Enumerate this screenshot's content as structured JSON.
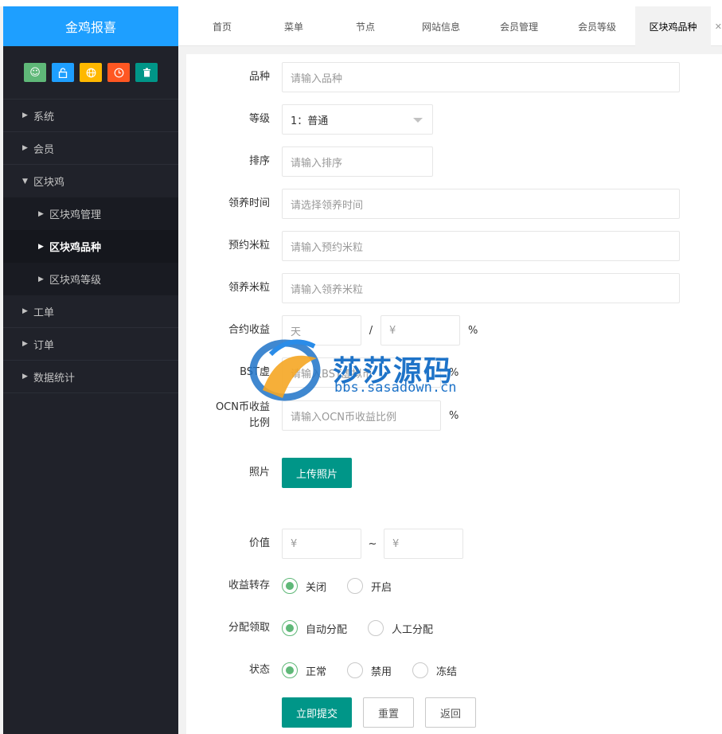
{
  "app": {
    "title": "金鸡报喜"
  },
  "quick_icons": [
    {
      "name": "user-icon",
      "color": "#5fb878",
      "glyph": "☺"
    },
    {
      "name": "lock-icon",
      "color": "#1e9fff",
      "glyph": "🔓"
    },
    {
      "name": "globe-icon",
      "color": "#ffb800",
      "glyph": "⊕"
    },
    {
      "name": "clock-icon",
      "color": "#ff5722",
      "glyph": "◷"
    },
    {
      "name": "trash-icon",
      "color": "#009688",
      "glyph": "🗑"
    }
  ],
  "sidebar": {
    "items": [
      {
        "label": "系统"
      },
      {
        "label": "会员"
      },
      {
        "label": "区块鸡"
      },
      {
        "label": "工单"
      },
      {
        "label": "订单"
      },
      {
        "label": "数据统计"
      }
    ],
    "sub_items": [
      {
        "label": "区块鸡管理"
      },
      {
        "label": "区块鸡品种"
      },
      {
        "label": "区块鸡等级"
      }
    ]
  },
  "tabs": [
    {
      "label": "首页"
    },
    {
      "label": "菜单"
    },
    {
      "label": "节点"
    },
    {
      "label": "网站信息"
    },
    {
      "label": "会员管理"
    },
    {
      "label": "会员等级"
    },
    {
      "label": "区块鸡品种"
    }
  ],
  "form": {
    "variety": {
      "label": "品种",
      "placeholder": "请输入品种"
    },
    "level": {
      "label": "等级",
      "value": "1：普通"
    },
    "sort": {
      "label": "排序",
      "placeholder": "请输入排序"
    },
    "adopt_time": {
      "label": "领养时间",
      "placeholder": "请选择领养时间"
    },
    "reserve_rice": {
      "label": "预约米粒",
      "placeholder": "请输入预约米粒"
    },
    "adopt_rice": {
      "label": "领养米粒",
      "placeholder": "请输入领养米粒"
    },
    "contract": {
      "label": "合约收益",
      "days_placeholder": "天",
      "sep": "/",
      "yen_placeholder": "¥",
      "unit": "%"
    },
    "bst": {
      "label": "BST虚",
      "placeholder": "请输入BST虚拟币",
      "unit": "%"
    },
    "ocn": {
      "label1": "OCN币收益",
      "label2": "比例",
      "placeholder": "请输入OCN币收益比例",
      "unit": "%"
    },
    "photo": {
      "label": "照片",
      "button": "上传照片"
    },
    "value": {
      "label": "价值",
      "min_placeholder": "¥",
      "sep": "~",
      "max_placeholder": "¥"
    },
    "transfer": {
      "label": "收益转存",
      "options": [
        "关闭",
        "开启"
      ]
    },
    "assign": {
      "label": "分配领取",
      "options": [
        "自动分配",
        "人工分配"
      ]
    },
    "status": {
      "label": "状态",
      "options": [
        "正常",
        "禁用",
        "冻结"
      ]
    },
    "buttons": {
      "submit": "立即提交",
      "reset": "重置",
      "back": "返回"
    }
  },
  "watermark": {
    "text": "莎莎源码",
    "url": "bbs.sasadown.cn"
  }
}
